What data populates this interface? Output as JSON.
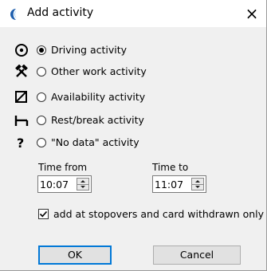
{
  "dialog": {
    "title": "Add activity",
    "close_symbol": "×"
  },
  "activities": [
    {
      "label": "Driving activity",
      "icon": "steering-wheel-icon",
      "selected": true
    },
    {
      "label": "Other work activity",
      "icon": "hammers-icon",
      "selected": false
    },
    {
      "label": "Availability activity",
      "icon": "availability-box-icon",
      "selected": false
    },
    {
      "label": "Rest/break activity",
      "icon": "bed-icon",
      "selected": false
    },
    {
      "label": "\"No data\" activity",
      "icon": "question-mark-icon",
      "selected": false
    }
  ],
  "time_from": {
    "label": "Time from",
    "value": "10:07"
  },
  "time_to": {
    "label": "Time to",
    "value": "11:07"
  },
  "stopover_option": {
    "label": "add at stopovers and card withdrawn only",
    "checked": true
  },
  "buttons": {
    "ok": "OK",
    "cancel": "Cancel"
  },
  "colors": {
    "accent": "#0078d7",
    "app_icon": "#2b7bd0"
  }
}
